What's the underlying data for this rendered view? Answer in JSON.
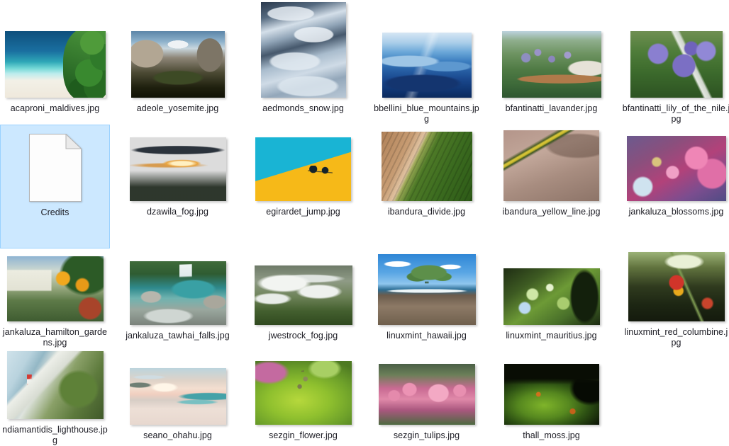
{
  "view": {
    "type": "file-explorer-thumbnail-grid",
    "columns": 6,
    "rows": 4,
    "background_color": "#ffffff",
    "selection_fill": "#cce8ff",
    "selection_border": "#99d1ff",
    "label_color": "#1c1c24"
  },
  "files": [
    {
      "name": "acaproni_maldives.jpg",
      "kind": "image",
      "art": "art-maldives",
      "w": 142,
      "h": 94,
      "selected": false
    },
    {
      "name": "adeole_yosemite.jpg",
      "kind": "image",
      "art": "art-yosemite",
      "w": 132,
      "h": 94,
      "selected": false
    },
    {
      "name": "aedmonds_snow.jpg",
      "kind": "image",
      "art": "art-snow",
      "w": 120,
      "h": 135,
      "selected": false
    },
    {
      "name": "bbellini_blue_mountains.jpg",
      "kind": "image",
      "art": "art-bluemtn",
      "w": 126,
      "h": 92,
      "selected": false
    },
    {
      "name": "bfantinatti_lavander.jpg",
      "kind": "image",
      "art": "art-lavander",
      "w": 140,
      "h": 94,
      "selected": false
    },
    {
      "name": "bfantinatti_lily_of_the_nile.jpg",
      "kind": "image",
      "art": "art-lily",
      "w": 130,
      "h": 94,
      "selected": false
    },
    {
      "name": "Credits",
      "kind": "text",
      "art": "",
      "w": 74,
      "h": 96,
      "selected": true
    },
    {
      "name": "dzawila_fog.jpg",
      "kind": "image",
      "art": "art-fogsunset",
      "w": 136,
      "h": 90,
      "selected": false
    },
    {
      "name": "egirardet_jump.jpg",
      "kind": "image",
      "art": "art-jump",
      "w": 135,
      "h": 90,
      "selected": false
    },
    {
      "name": "ibandura_divide.jpg",
      "kind": "image",
      "art": "art-divide",
      "w": 128,
      "h": 98,
      "selected": false
    },
    {
      "name": "ibandura_yellow_line.jpg",
      "kind": "image",
      "art": "art-yellowline",
      "w": 135,
      "h": 100,
      "selected": false
    },
    {
      "name": "jankaluza_blossoms.jpg",
      "kind": "image",
      "art": "art-blossoms",
      "w": 140,
      "h": 92,
      "selected": false
    },
    {
      "name": "jankaluza_hamilton_gardens.jpg",
      "kind": "image",
      "art": "art-hamilton",
      "w": 136,
      "h": 92,
      "selected": false
    },
    {
      "name": "jankaluza_tawhai_falls.jpg",
      "kind": "image",
      "art": "art-falls",
      "w": 136,
      "h": 90,
      "selected": false
    },
    {
      "name": "jwestrock_fog.jpg",
      "kind": "image",
      "art": "art-fogforest",
      "w": 138,
      "h": 84,
      "selected": false
    },
    {
      "name": "linuxmint_hawaii.jpg",
      "kind": "image",
      "art": "art-hawaii",
      "w": 138,
      "h": 100,
      "selected": false
    },
    {
      "name": "linuxmint_mauritius.jpg",
      "kind": "image",
      "art": "art-mauritius",
      "w": 136,
      "h": 80,
      "selected": false
    },
    {
      "name": "linuxmint_red_columbine.jpg",
      "kind": "image",
      "art": "art-columbine",
      "w": 136,
      "h": 98,
      "selected": false
    },
    {
      "name": "ndiamantidis_lighthouse.jpg",
      "kind": "image",
      "art": "art-lighthouse",
      "w": 136,
      "h": 96,
      "selected": false
    },
    {
      "name": "seano_ohahu.jpg",
      "kind": "image",
      "art": "art-ohahu",
      "w": 136,
      "h": 80,
      "selected": false
    },
    {
      "name": "sezgin_flower.jpg",
      "kind": "image",
      "art": "art-flower",
      "w": 136,
      "h": 90,
      "selected": false
    },
    {
      "name": "sezgin_tulips.jpg",
      "kind": "image",
      "art": "art-tulips",
      "w": 136,
      "h": 86,
      "selected": false
    },
    {
      "name": "thall_moss.jpg",
      "kind": "image",
      "art": "art-moss",
      "w": 134,
      "h": 86,
      "selected": false
    }
  ],
  "icons": {
    "text_file": "text-file-icon"
  }
}
